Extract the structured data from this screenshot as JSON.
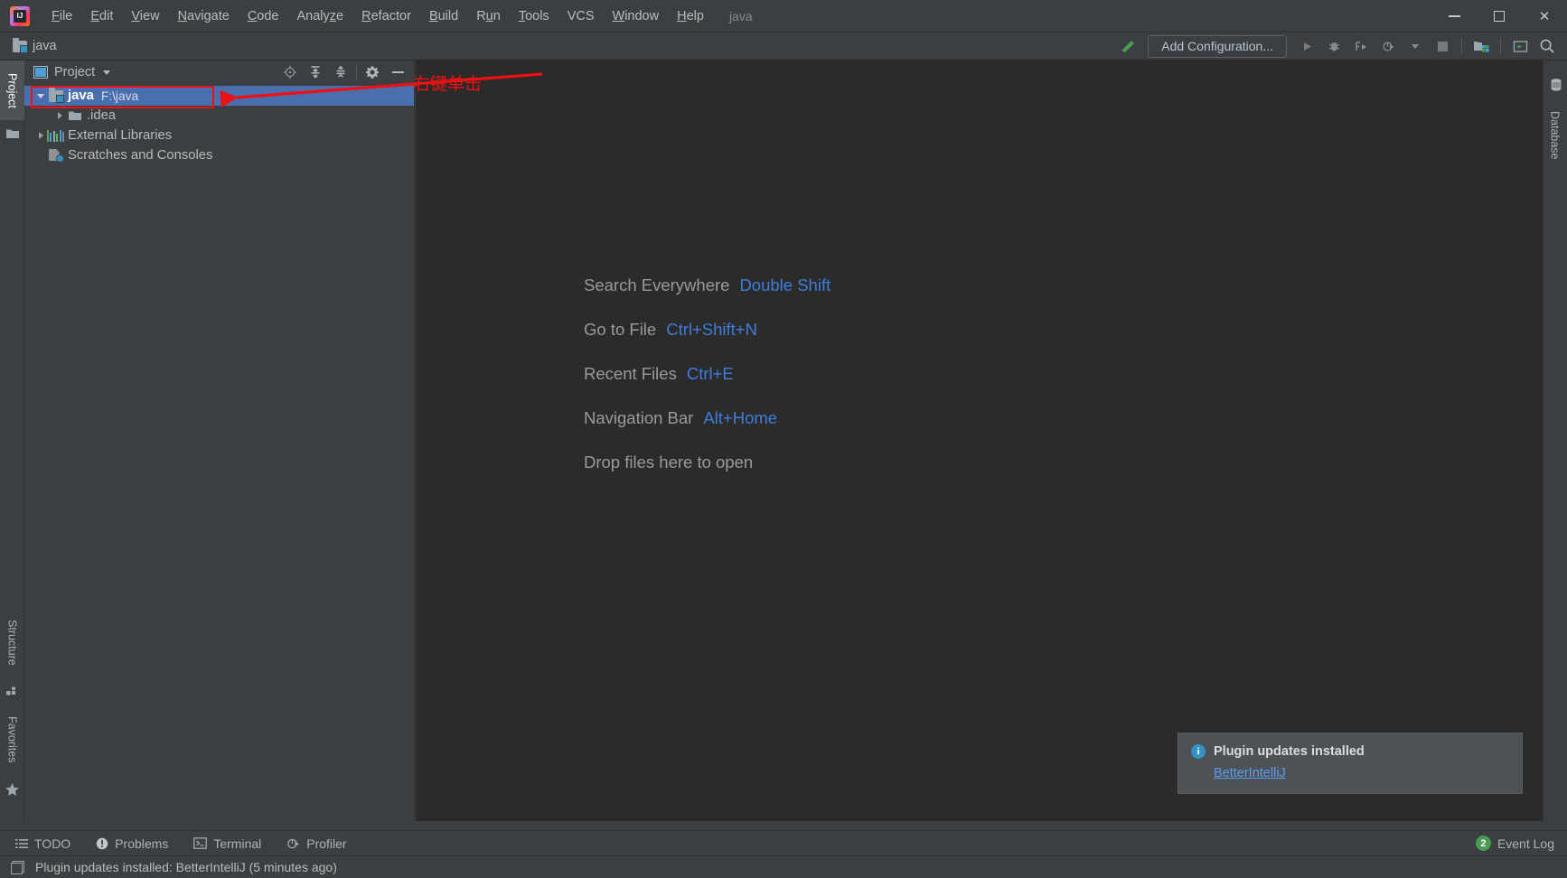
{
  "window": {
    "title": "java",
    "controls": {
      "minimize": "minimize-icon",
      "maximize": "maximize-icon",
      "close": "close-icon"
    }
  },
  "menubar": {
    "logo": "intellij-idea-logo",
    "items": [
      {
        "label": "File",
        "mnemonic": "F"
      },
      {
        "label": "Edit",
        "mnemonic": "E"
      },
      {
        "label": "View",
        "mnemonic": "V"
      },
      {
        "label": "Navigate",
        "mnemonic": "N"
      },
      {
        "label": "Code",
        "mnemonic": "C"
      },
      {
        "label": "Analyze",
        "mnemonic": "z"
      },
      {
        "label": "Refactor",
        "mnemonic": "R"
      },
      {
        "label": "Build",
        "mnemonic": "B"
      },
      {
        "label": "Run",
        "mnemonic": "u"
      },
      {
        "label": "Tools",
        "mnemonic": "T"
      },
      {
        "label": "VCS",
        "mnemonic": ""
      },
      {
        "label": "Window",
        "mnemonic": "W"
      },
      {
        "label": "Help",
        "mnemonic": "H"
      }
    ]
  },
  "toolbar": {
    "breadcrumb": "java",
    "breadcrumb_icon": "folder-module-icon",
    "build_icon": "build-hammer-icon",
    "add_configuration_label": "Add Configuration...",
    "run_icon": "run-icon",
    "debug_icon": "debug-icon",
    "run_with_coverage_icon": "run-with-coverage-icon",
    "profile_icon": "profile-icon",
    "dropdown_icon": "chevron-down-icon",
    "stop_icon": "stop-icon",
    "project_structure_icon": "project-structure-icon",
    "terminal_icon": "terminal-icon",
    "search_icon": "search-icon"
  },
  "left_stripe": {
    "tabs": [
      {
        "label": "Project",
        "icon": "project-icon",
        "active": true
      },
      {
        "label": "Structure",
        "icon": "structure-icon",
        "active": false
      },
      {
        "label": "Favorites",
        "icon": "star-icon",
        "active": false
      }
    ],
    "folder_icon": "folder-icon"
  },
  "right_stripe": {
    "tabs": [
      {
        "label": "Database",
        "icon": "database-icon",
        "active": false
      }
    ]
  },
  "project_panel": {
    "title": "Project",
    "view_icon": "project-view-icon",
    "dropdown_icon": "chevron-down-icon",
    "actions": [
      {
        "name": "scroll-from-source-icon",
        "label": "Select Opened File"
      },
      {
        "name": "expand-all-icon",
        "label": "Expand All"
      },
      {
        "name": "collapse-all-icon",
        "label": "Collapse All"
      },
      {
        "name": "settings-gear-icon",
        "label": "Settings"
      },
      {
        "name": "hide-icon",
        "label": "Hide"
      }
    ],
    "tree": [
      {
        "name": "java",
        "path": "F:\\java",
        "icon": "folder-module-icon",
        "twisty": "expanded",
        "indent": 0,
        "selected": true,
        "bold": true
      },
      {
        "name": ".idea",
        "path": "",
        "icon": "folder-icon",
        "twisty": "collapsed",
        "indent": 1,
        "selected": false,
        "bold": false
      },
      {
        "name": "External Libraries",
        "path": "",
        "icon": "library-icon",
        "twisty": "collapsed",
        "indent": 0,
        "selected": false,
        "bold": false
      },
      {
        "name": "Scratches and Consoles",
        "path": "",
        "icon": "scratches-icon",
        "twisty": "none",
        "indent": 0,
        "selected": false,
        "bold": false
      }
    ]
  },
  "editor": {
    "shortcuts": [
      {
        "action": "Search Everywhere",
        "keys": "Double Shift"
      },
      {
        "action": "Go to File",
        "keys": "Ctrl+Shift+N"
      },
      {
        "action": "Recent Files",
        "keys": "Ctrl+E"
      },
      {
        "action": "Navigation Bar",
        "keys": "Alt+Home"
      }
    ],
    "drop_hint": "Drop files here to open"
  },
  "notification": {
    "icon": "info-icon",
    "icon_glyph": "i",
    "title": "Plugin updates installed",
    "link": "BetterIntelliJ"
  },
  "bottom_bar": {
    "tabs": [
      {
        "label": "TODO",
        "icon": "todo-list-icon"
      },
      {
        "label": "Problems",
        "icon": "problems-warning-icon"
      },
      {
        "label": "Terminal",
        "icon": "terminal-icon"
      },
      {
        "label": "Profiler",
        "icon": "profiler-icon"
      }
    ],
    "event_log": {
      "label": "Event Log",
      "count": "2"
    }
  },
  "status_bar": {
    "icon": "status-window-icon",
    "message": "Plugin updates installed: BetterIntelliJ (5 minutes ago)"
  },
  "annotation": {
    "text": "右键单击",
    "arrow": "red-arrow-pointing-left",
    "highlight_box": "red-rectangle-around-selected-node",
    "color": "#ee1111"
  },
  "colors": {
    "background": "#3c3f41",
    "editor_background": "#2b2b2b",
    "selection": "#4b6eaf",
    "link": "#589df6",
    "shortcut_key": "#3e7ddb",
    "annotation": "#ee1111",
    "badge_green": "#499c54",
    "info_blue": "#3592c4"
  }
}
